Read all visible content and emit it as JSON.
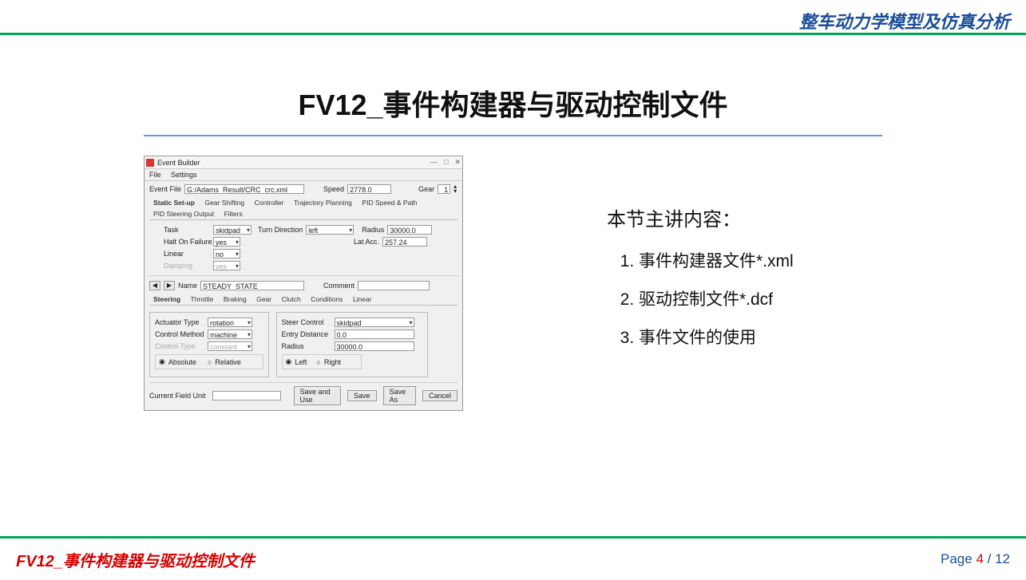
{
  "header": {
    "title": "整车动力学模型及仿真分析"
  },
  "slide": {
    "title": "FV12_事件构建器与驱动控制文件",
    "section_head": "本节主讲内容：",
    "toc": [
      "事件构建器文件*.xml",
      "驱动控制文件*.dcf",
      "事件文件的使用"
    ]
  },
  "eb": {
    "window_title": "Event Builder",
    "menu": {
      "file": "File",
      "settings": "Settings"
    },
    "top": {
      "event_file_label": "Event File",
      "event_file_value": "G:/Adams_Result/CRC_crc.xml",
      "speed_label": "Speed",
      "speed_value": "2778.0",
      "gear_label": "Gear",
      "gear_value": "1"
    },
    "tabs1": [
      "Static Set-up",
      "Gear Shifting",
      "Controller",
      "Trajectory Planning",
      "PID Speed & Path",
      "PID Steering Output",
      "Filters"
    ],
    "setup": {
      "task_label": "Task",
      "task_value": "skidpad",
      "turn_dir_label": "Turn Direction",
      "turn_dir_value": "left",
      "radius_label": "Radius",
      "radius_value": "30000.0",
      "halt_label": "Halt On Failure",
      "halt_value": "yes",
      "latacc_label": "Lat Acc.",
      "latacc_value": "257.24",
      "linear_label": "Linear",
      "linear_value": "no",
      "damping_label": "Damping",
      "damping_value": "yes"
    },
    "name_row": {
      "name_label": "Name",
      "name_value": "STEADY_STATE",
      "comment_label": "Comment",
      "comment_value": ""
    },
    "tabs2": [
      "Steering",
      "Throttle",
      "Braking",
      "Gear",
      "Clutch",
      "Conditions",
      "Linear"
    ],
    "panel_left": {
      "actuator_label": "Actuator Type",
      "actuator_value": "rotation",
      "method_label": "Control Method",
      "method_value": "machine",
      "ctype_label": "Control Type",
      "ctype_value": "constant",
      "abs_label": "Absolute",
      "rel_label": "Relative"
    },
    "panel_right": {
      "steer_label": "Steer Control",
      "steer_value": "skidpad",
      "entry_label": "Entry Distance",
      "entry_value": "0.0",
      "radius_label": "Radius",
      "radius_value": "30000.0",
      "left_label": "Left",
      "right_label": "Right"
    },
    "bottom": {
      "unit_label": "Current Field Unit",
      "save_use": "Save and Use",
      "save": "Save",
      "save_as": "Save As",
      "cancel": "Cancel"
    }
  },
  "footer": {
    "left": "FV12_事件构建器与驱动控制文件",
    "page_label": "Page",
    "page_current": "4",
    "page_total": "12"
  }
}
